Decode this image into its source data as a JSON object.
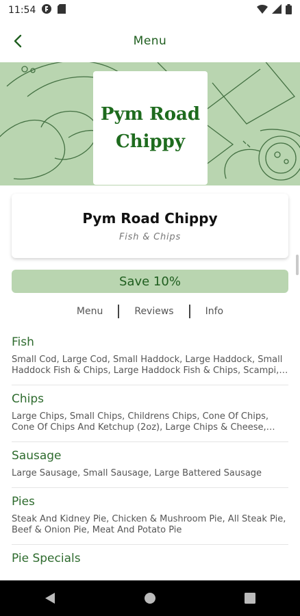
{
  "status": {
    "time": "11:54"
  },
  "app_bar": {
    "title": "Menu"
  },
  "logo": {
    "line1": "Pym Road",
    "line2": "Chippy"
  },
  "shop": {
    "name": "Pym Road Chippy",
    "category": "Fish & Chips"
  },
  "offer": {
    "label": "Save 10%"
  },
  "tabs": [
    {
      "label": "Menu"
    },
    {
      "label": "Reviews"
    },
    {
      "label": "Info"
    }
  ],
  "menu": [
    {
      "title": "Fish",
      "items": "Small Cod, Large Cod, Small Haddock, Large Haddock, Small Haddock Fish & Chips, Large Haddock Fish & Chips, Scampi, Fish Cake, Large Cod Fish & Chips"
    },
    {
      "title": "Chips",
      "items": "Large Chips, Small Chips, Childrens Chips, Cone Of Chips, Cone Of Chips And Ketchup (2oz), Large Chips & Cheese, Small Chips & Cheese"
    },
    {
      "title": "Sausage",
      "items": "Large Sausage, Small Sausage, Large Battered Sausage"
    },
    {
      "title": "Pies",
      "items": "Steak And Kidney Pie, Chicken & Mushroom Pie, All Steak Pie, Beef & Onion Pie, Meat And Potato Pie"
    },
    {
      "title": "Pie Specials",
      "items": ""
    }
  ],
  "colors": {
    "accent": "#1f5e1f",
    "hero": "#b9d5b0",
    "nav": "#000000"
  }
}
